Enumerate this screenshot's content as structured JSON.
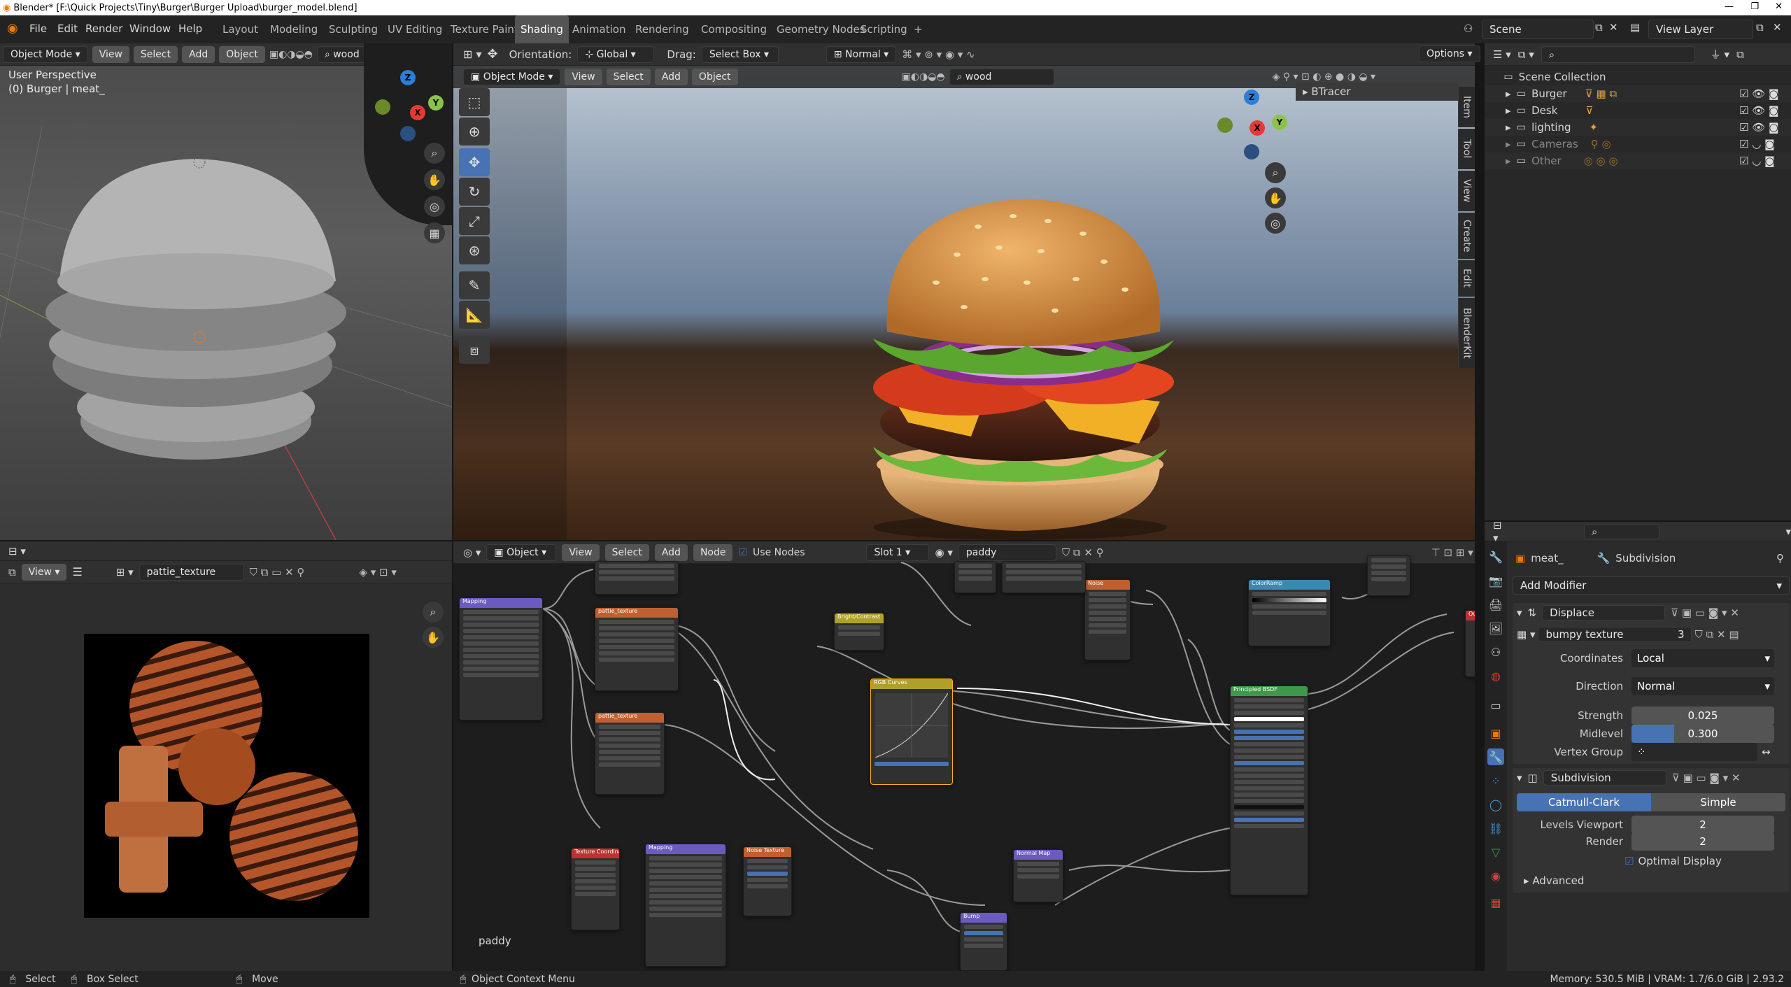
{
  "window": {
    "title": "Blender* [F:\\Quick Projects\\Tiny\\Burger\\Burger Upload\\burger_model.blend]"
  },
  "menubar": {
    "file": "File",
    "edit": "Edit",
    "render": "Render",
    "window": "Window",
    "help": "Help",
    "workspaces": [
      "Layout",
      "Modeling",
      "Sculpting",
      "UV Editing",
      "Texture Paint",
      "Shading",
      "Animation",
      "Rendering",
      "Compositing",
      "Geometry Nodes",
      "Scripting"
    ],
    "active_workspace": "Shading",
    "add_workspace": "+",
    "scene": "Scene",
    "view_layer": "View Layer"
  },
  "left_viewport": {
    "mode": "Object Mode",
    "view": "View",
    "select": "Select",
    "add": "Add",
    "object": "Object",
    "search": "wood",
    "perspective": "User Perspective",
    "object_label": "(0) Burger | meat_"
  },
  "header3d": {
    "orientation_label": "Orientation:",
    "orientation": "Global",
    "drag_label": "Drag:",
    "drag": "Select Box",
    "pivot": "Normal",
    "options": "Options"
  },
  "main_viewport": {
    "mode": "Object Mode",
    "view": "View",
    "select": "Select",
    "add": "Add",
    "object": "Object",
    "search": "wood",
    "panel": "BTracer",
    "sidetabs": [
      "Item",
      "Tool",
      "View",
      "Create",
      "Edit",
      "BlenderKit"
    ]
  },
  "image_editor": {
    "view": "View",
    "image_name": "pattie_texture"
  },
  "node_editor": {
    "type": "Object",
    "view": "View",
    "select": "Select",
    "add": "Add",
    "node": "Node",
    "use_nodes": "Use Nodes",
    "slot": "Slot 1",
    "material": "paddy",
    "label": "paddy"
  },
  "outliner": {
    "root": "Scene Collection",
    "items": [
      {
        "name": "Burger",
        "dim": false
      },
      {
        "name": "Desk",
        "dim": false
      },
      {
        "name": "lighting",
        "dim": false
      },
      {
        "name": "Cameras",
        "dim": true
      },
      {
        "name": "Other",
        "dim": true
      }
    ]
  },
  "properties": {
    "object": "meat_",
    "modifier_tab": "Subdivision",
    "add_modifier": "Add Modifier",
    "displace": {
      "name": "Displace",
      "texture": "bumpy texture",
      "users": "3",
      "coordinates_label": "Coordinates",
      "coordinates": "Local",
      "direction_label": "Direction",
      "direction": "Normal",
      "strength_label": "Strength",
      "strength": "0.025",
      "midlevel_label": "Midlevel",
      "midlevel": "0.300",
      "midlevel_fraction": 0.3,
      "vertex_group_label": "Vertex Group"
    },
    "subdivision": {
      "name": "Subdivision",
      "catmull": "Catmull-Clark",
      "simple": "Simple",
      "levels_label": "Levels Viewport",
      "levels": "2",
      "render_label": "Render",
      "render": "2",
      "optimal": "Optimal Display",
      "advanced": "Advanced"
    }
  },
  "statusbar": {
    "select": "Select",
    "box_select": "Box Select",
    "move": "Move",
    "context": "Object Context Menu",
    "memory": "Memory: 530.5 MiB | VRAM: 1.7/6.0 GiB | 2.93.2"
  },
  "colors": {
    "accent": "#4772b3",
    "panel": "#303030",
    "bg": "#232323"
  }
}
